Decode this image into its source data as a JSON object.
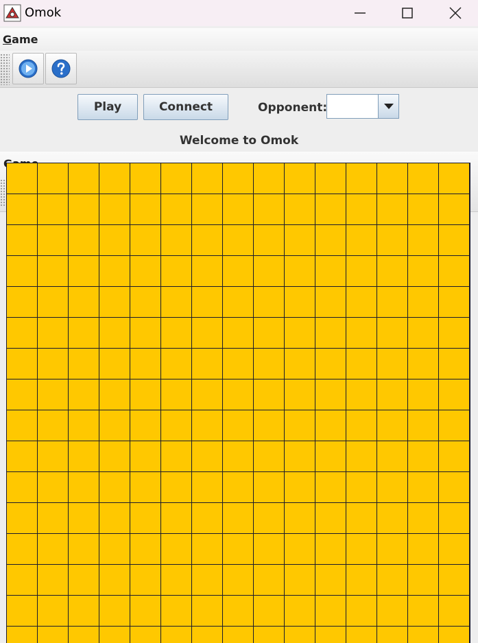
{
  "window": {
    "title": "Omok",
    "controls": [
      "minimize",
      "maximize",
      "close"
    ]
  },
  "menu": {
    "items": [
      {
        "label": "Game",
        "mnemonic": "G"
      }
    ]
  },
  "toolbar": {
    "buttons": [
      {
        "name": "play",
        "icon": "play-circle-icon"
      },
      {
        "name": "help",
        "icon": "help-circle-icon"
      }
    ]
  },
  "controls": {
    "play_label": "Play",
    "connect_label": "Connect",
    "opponent_label": "Opponent:",
    "opponent_value": ""
  },
  "status": {
    "message": "Welcome to Omok"
  },
  "overlapped_menu": {
    "label": "Game"
  },
  "board": {
    "color": "#ffc800",
    "grid_color": "#1a1a2e",
    "columns": 15,
    "rows": 15
  },
  "colors": {
    "titlebar": "#f7eef4",
    "button_border": "#7f9db9",
    "icon_blue": "#2a6fc9"
  }
}
